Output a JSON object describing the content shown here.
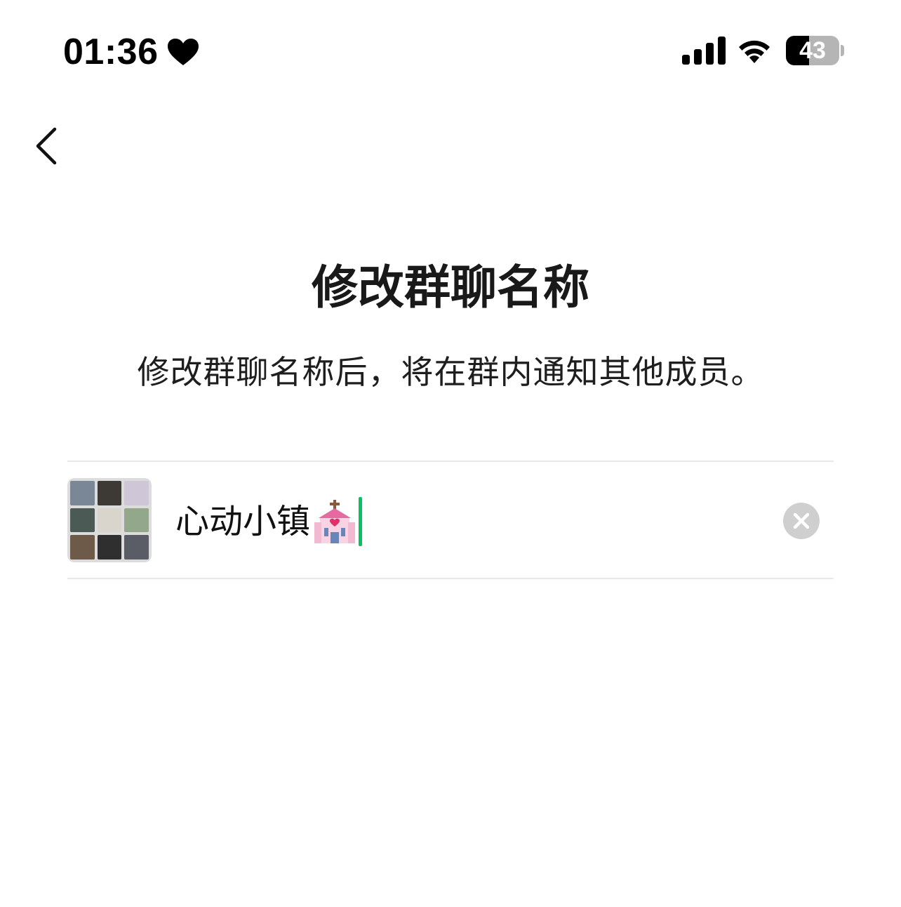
{
  "status_bar": {
    "time": "01:36",
    "battery_label": "43",
    "battery_level": 0.43,
    "icons": [
      "heart-icon",
      "signal-icon",
      "wifi-icon",
      "battery-icon"
    ]
  },
  "nav": {
    "back_icon": "chevron-left-icon"
  },
  "main": {
    "title": "修改群聊名称",
    "subtitle": "修改群聊名称后，将在群内通知其他成员。",
    "name_input": {
      "value": "心动小镇",
      "emoji_icon": "wedding-chapel-icon",
      "cursor_color": "#07c160"
    },
    "clear_icon": "clear-icon",
    "avatar_tiles": [
      "#7a8796",
      "#3d3a36",
      "#cfc6d8",
      "#4c5a56",
      "#d9d4cc",
      "#93a88a",
      "#6e5a48",
      "#2f2f2f",
      "#5a5c66"
    ]
  },
  "colors": {
    "accent": "#07c160",
    "divider": "#e8e8e8",
    "background": "#ffffff"
  }
}
